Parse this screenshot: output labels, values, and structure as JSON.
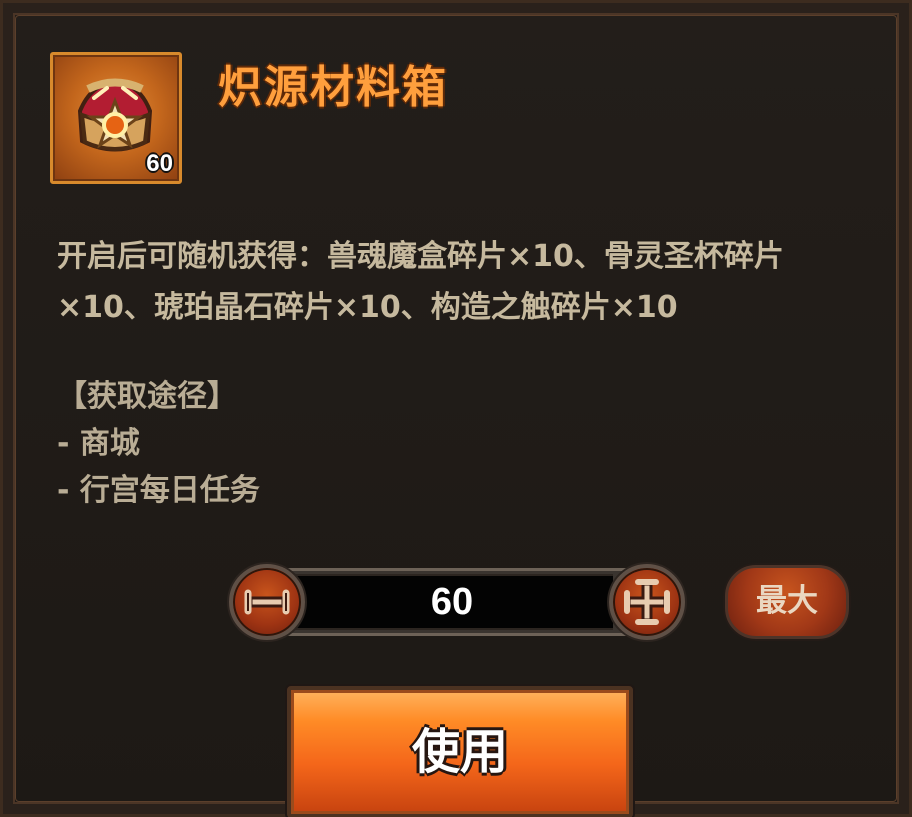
{
  "item": {
    "name": "炽源材料箱",
    "count": "60",
    "icon": "treasure-chest-icon"
  },
  "description": "开启后可随机获得：兽魂魔盒碎片×10、骨灵圣杯碎片×10、琥珀晶石碎片×10、构造之触碎片×10",
  "sources": {
    "heading": "【获取途径】",
    "items": [
      "- 商城",
      "- 行宫每日任务"
    ]
  },
  "quantity": {
    "value": "60"
  },
  "buttons": {
    "max_label": "最大",
    "use_label": "使用"
  },
  "theme": {
    "accent": "#ff9f3d",
    "button_orange": "#f4661a",
    "text": "#c6b99e"
  }
}
